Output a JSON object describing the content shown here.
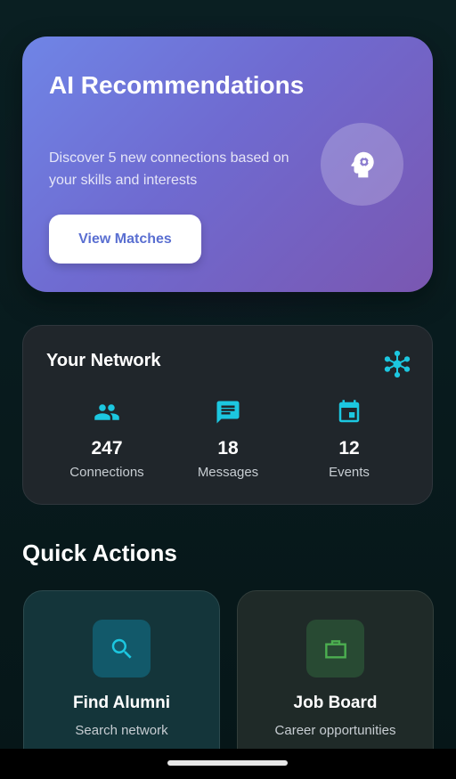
{
  "ai_card": {
    "title": "AI Recommendations",
    "subtitle": "Discover 5 new connections based on your skills and interests",
    "button_label": "View Matches",
    "icon": "psychology-brain-icon",
    "gradient": [
      "#6f85e6",
      "#7a57b1"
    ]
  },
  "network": {
    "title": "Your Network",
    "icon": "hub-network-icon",
    "accent": "#1cc7e0",
    "stats": [
      {
        "icon": "people-icon",
        "value": "247",
        "label": "Connections"
      },
      {
        "icon": "chat-icon",
        "value": "18",
        "label": "Messages"
      },
      {
        "icon": "calendar-icon",
        "value": "12",
        "label": "Events"
      }
    ]
  },
  "quick_actions": {
    "title": "Quick Actions",
    "items": [
      {
        "icon": "search-icon",
        "label": "Find Alumni",
        "description": "Search network",
        "color": "#1cc7e0"
      },
      {
        "icon": "briefcase-icon",
        "label": "Job Board",
        "description": "Career opportunities",
        "color": "#4caf50"
      }
    ]
  }
}
